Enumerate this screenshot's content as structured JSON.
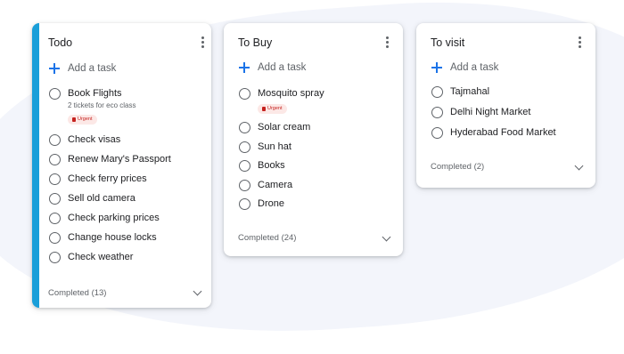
{
  "lists": [
    {
      "title": "Todo",
      "add_label": "Add a task",
      "tasks": [
        {
          "title": "Book Flights",
          "note": "2 tickets for eco class",
          "badge": "Urgent"
        },
        {
          "title": "Check visas"
        },
        {
          "title": "Renew Mary's Passport"
        },
        {
          "title": "Check ferry prices"
        },
        {
          "title": "Sell old camera"
        },
        {
          "title": "Check parking prices"
        },
        {
          "title": "Change house locks"
        },
        {
          "title": "Check weather"
        }
      ],
      "completed_label": "Completed (13)"
    },
    {
      "title": "To Buy",
      "add_label": "Add a task",
      "tasks": [
        {
          "title": "Mosquito spray",
          "badge": "Urgent"
        },
        {
          "title": "Solar cream"
        },
        {
          "title": "Sun hat"
        },
        {
          "title": "Books"
        },
        {
          "title": "Camera"
        },
        {
          "title": "Drone"
        }
      ],
      "completed_label": "Completed (24)"
    },
    {
      "title": "To visit",
      "add_label": "Add a task",
      "tasks": [
        {
          "title": "Tajmahal"
        },
        {
          "title": "Delhi Night Market"
        },
        {
          "title": "Hyderabad Food Market"
        }
      ],
      "completed_label": "Completed (2)"
    }
  ],
  "colors": {
    "accent": "#1a9fd9",
    "add_icon": "#1a73e8",
    "badge_bg": "#fce8e6",
    "badge_text": "#c5221f"
  },
  "icons": [
    "more-vert-icon",
    "plus-icon",
    "circle-checkbox-icon",
    "flag-icon",
    "chevron-down-icon"
  ]
}
